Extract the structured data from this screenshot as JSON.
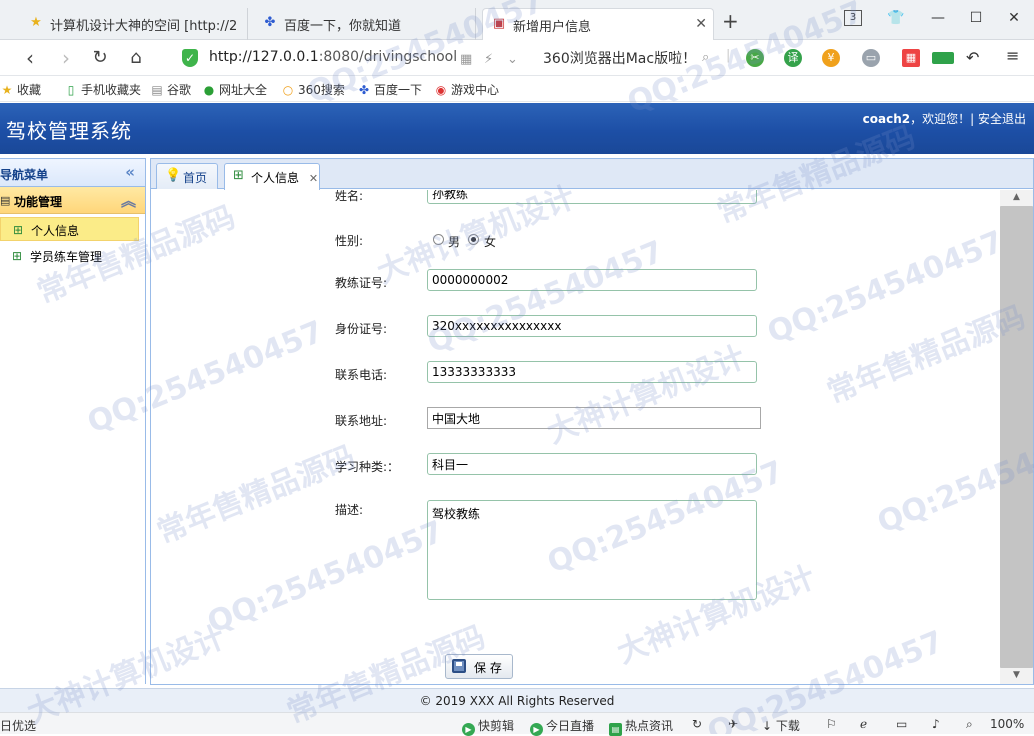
{
  "browser": {
    "tabs": [
      {
        "title": "计算机设计大神的空间 [http://2"
      },
      {
        "title": "百度一下，你就知道"
      },
      {
        "title": "新增用户信息"
      }
    ],
    "tab_count_badge": "3",
    "url_host": "http://127.0.0.1",
    "url_rest": ":8080/drivingschool",
    "promo_text": "360浏览器出Mac版啦！",
    "bookmarks": [
      "收藏",
      "手机收藏夹",
      "谷歌",
      "网址大全",
      "360搜索",
      "百度一下",
      "游戏中心"
    ]
  },
  "app": {
    "title": "驾校管理系统",
    "username": "coach2",
    "welcome": "，欢迎您！|",
    "logout": "安全退出"
  },
  "leftnav": {
    "header": "导航菜单",
    "panel_title": "功能管理",
    "items": [
      {
        "label": "个人信息"
      },
      {
        "label": "学员练车管理"
      }
    ]
  },
  "content_tabs": [
    {
      "label": "首页"
    },
    {
      "label": "个人信息"
    }
  ],
  "form": {
    "name_label": "姓名:",
    "name_value": "孙教练",
    "gender_label": "性别:",
    "gender_options": [
      "男",
      "女"
    ],
    "gender_selected": "女",
    "license_label": "教练证号:",
    "license_value": "0000000002",
    "idcard_label": "身份证号:",
    "idcard_value": "320xxxxxxxxxxxxxxx",
    "phone_label": "联系电话:",
    "phone_value": "13333333333",
    "address_label": "联系地址:",
    "address_value": "中国大地",
    "course_label": "学习种类:：",
    "course_value": "科目一",
    "desc_label": "描述:",
    "desc_value": "驾校教练",
    "save_label": "保 存"
  },
  "footer": {
    "copyright": "© 2019 XXX All Rights Reserved"
  },
  "statusbar": {
    "left": "日优选",
    "items": [
      "快剪辑",
      "今日直播",
      "热点资讯",
      "下载"
    ],
    "zoom": "100%"
  },
  "watermarks": [
    "QQ:254540457",
    "常年售精品源码",
    "大神计算机设计"
  ]
}
